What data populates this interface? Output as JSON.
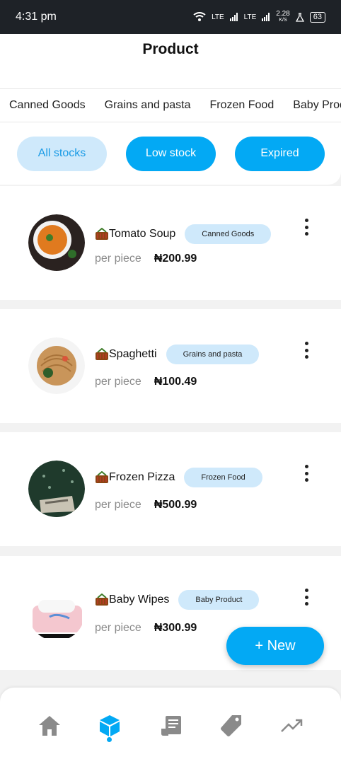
{
  "status_bar": {
    "time": "4:31 pm",
    "network": "LTE",
    "network2": "LTE",
    "speed": "2.28",
    "speed_unit": "K/S",
    "battery": "63"
  },
  "header": {
    "title": "Product"
  },
  "category_tabs": [
    "Canned Goods",
    "Grains and pasta",
    "Frozen Food",
    "Baby Prod"
  ],
  "filters": [
    "All stocks",
    "Low stock",
    "Expired"
  ],
  "products": [
    {
      "name": "Tomato Soup",
      "category": "Canned Goods",
      "unit": "per piece",
      "price": "₦200.99",
      "image": "tomato-soup-image"
    },
    {
      "name": "Spaghetti",
      "category": "Grains and pasta",
      "unit": "per piece",
      "price": "₦100.49",
      "image": "spaghetti-image"
    },
    {
      "name": "Frozen Pizza",
      "category": "Frozen Food",
      "unit": "per piece",
      "price": "₦500.99",
      "image": "frozen-pizza-image"
    },
    {
      "name": "Baby Wipes",
      "category": "Baby Product",
      "unit": "per piece",
      "price": "₦300.99",
      "image": "baby-wipes-image"
    }
  ],
  "fab": {
    "label": "+ New"
  },
  "bottom_nav": [
    {
      "icon": "home-icon",
      "active": false
    },
    {
      "icon": "cube-icon",
      "active": true
    },
    {
      "icon": "receipt-icon",
      "active": false
    },
    {
      "icon": "tag-icon",
      "active": false
    },
    {
      "icon": "trending-up-icon",
      "active": false
    }
  ],
  "colors": {
    "accent": "#03a9f4",
    "accent_light": "#cfe9fb",
    "nav_icon": "#8a8a8a"
  }
}
